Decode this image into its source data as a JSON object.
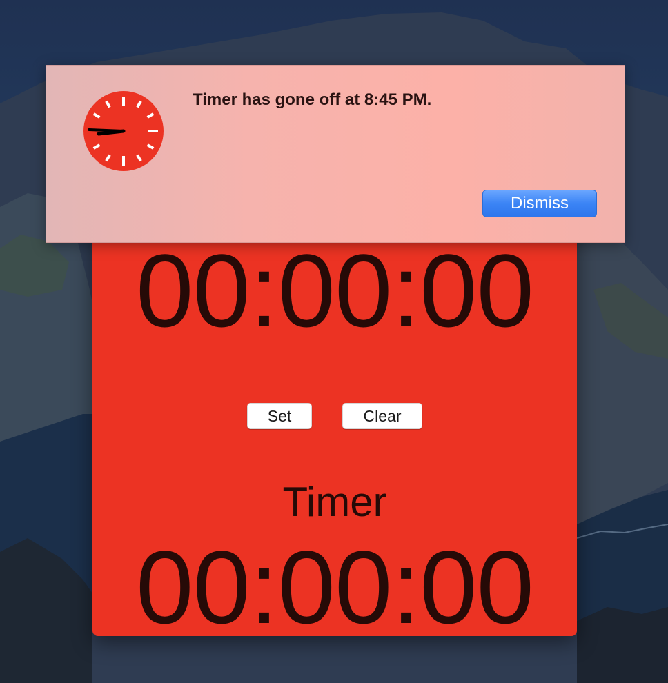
{
  "alert": {
    "icon": "clock-icon",
    "message": "Timer has gone off at 8:45 PM.",
    "dismiss_label": "Dismiss",
    "accent_color": "#3b84f5"
  },
  "app": {
    "background_color": "#ec3323",
    "clock_value": "00:00:00",
    "buttons": {
      "set_label": "Set",
      "clear_label": "Clear"
    },
    "timer_label": "Timer",
    "timer_value": "00:00:00"
  }
}
